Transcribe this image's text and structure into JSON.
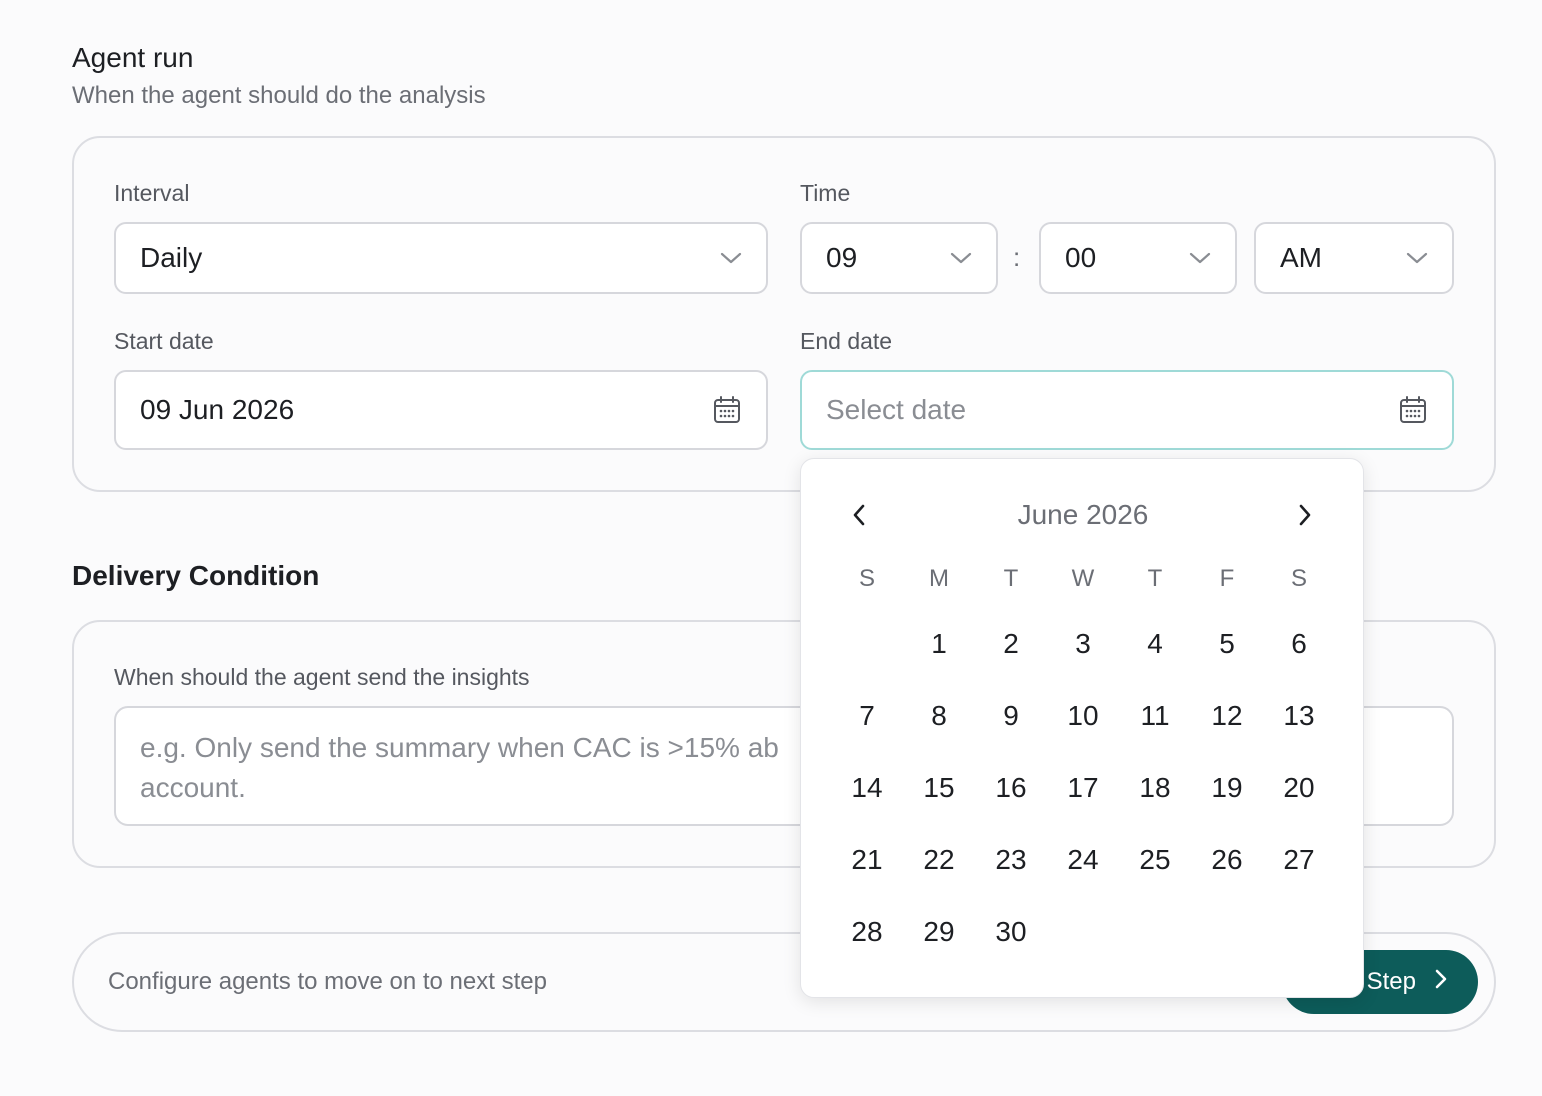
{
  "agent_run": {
    "title": "Agent run",
    "subtitle": "When the agent should do the analysis",
    "interval": {
      "label": "Interval",
      "value": "Daily"
    },
    "time": {
      "label": "Time",
      "hour": "09",
      "separator": ":",
      "minute": "00",
      "period": "AM"
    },
    "start_date": {
      "label": "Start date",
      "value": "09 Jun 2026"
    },
    "end_date": {
      "label": "End date",
      "placeholder": "Select date"
    }
  },
  "delivery": {
    "title": "Delivery Condition",
    "question": "When should the agent send the insights",
    "placeholder": "e.g. Only send the summary when CAC is >15% ab",
    "placeholder_line2": "account."
  },
  "footer": {
    "text": "Configure agents to move on to next step",
    "next_label": "Step"
  },
  "datepicker": {
    "month_label": "June 2026",
    "weekdays": [
      "S",
      "M",
      "T",
      "W",
      "T",
      "F",
      "S"
    ],
    "weeks": [
      [
        "",
        "1",
        "2",
        "3",
        "4",
        "5",
        "6"
      ],
      [
        "7",
        "8",
        "9",
        "10",
        "11",
        "12",
        "13"
      ],
      [
        "14",
        "15",
        "16",
        "17",
        "18",
        "19",
        "20"
      ],
      [
        "21",
        "22",
        "23",
        "24",
        "25",
        "26",
        "27"
      ],
      [
        "28",
        "29",
        "30",
        "",
        "",
        "",
        ""
      ]
    ]
  },
  "colors": {
    "accent": "#0d5c5a",
    "focus_border": "#9fdad7"
  },
  "icons": [
    "chevron-down-icon",
    "calendar-icon",
    "chevron-left-icon",
    "chevron-right-icon"
  ]
}
